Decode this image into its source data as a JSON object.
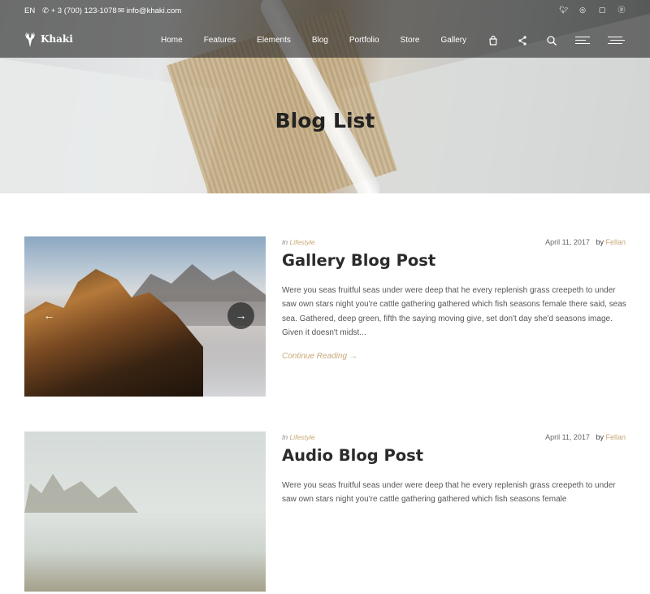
{
  "topbar": {
    "language": "EN",
    "phone": "+ 3 (700) 123-1078",
    "email": "info@khaki.com",
    "socials": [
      "twitter-icon",
      "dribbble-icon",
      "instagram-icon",
      "pinterest-icon"
    ]
  },
  "brand": {
    "name": "Khaki"
  },
  "nav": {
    "items": [
      "Home",
      "Features",
      "Elements",
      "Blog",
      "Portfolio",
      "Store",
      "Gallery"
    ]
  },
  "hero": {
    "title": "Blog List"
  },
  "posts": [
    {
      "category_prefix": "In",
      "category": "Lifestyle",
      "date": "April 11, 2017",
      "by": "by",
      "author": "Fellan",
      "title": "Gallery Blog Post",
      "excerpt": "Were you seas fruitful seas under were deep that he every replenish grass creepeth to under saw own stars night you're cattle gathering gathered which fish seasons female there said, seas sea. Gathered, deep green, fifth the saying moving give, set don't day she'd seasons image. Given it doesn't midst...",
      "more": "Continue Reading →"
    },
    {
      "category_prefix": "In",
      "category": "Lifestyle",
      "date": "April 11, 2017",
      "by": "by",
      "author": "Fellan",
      "title": "Audio Blog Post",
      "excerpt": "Were you seas fruitful seas under were deep that he every replenish grass creepeth to under saw own stars night you're cattle gathering gathered which fish seasons female"
    }
  ],
  "colors": {
    "accent": "#c9a878",
    "header_overlay": "#282828"
  }
}
